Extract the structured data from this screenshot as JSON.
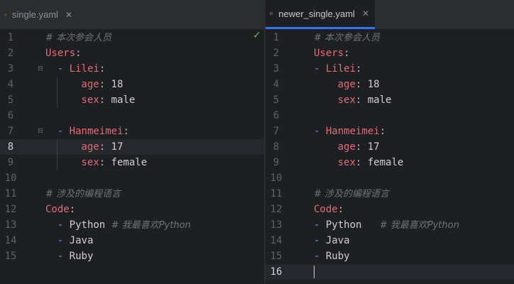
{
  "colors": {
    "accent": "#3574f0",
    "key": "#e06c75",
    "dash": "#56a8f5",
    "comment": "#6f737a"
  },
  "left": {
    "tab": {
      "label": "single.yaml",
      "close": "✕",
      "icon": "yaml-file-icon"
    },
    "line_numbers": [
      "1",
      "2",
      "3",
      "4",
      "5",
      "6",
      "7",
      "8",
      "9",
      "10",
      "11",
      "12",
      "13",
      "14",
      "15"
    ],
    "current_line": "8",
    "lines": [
      {
        "comment": "# 本次参会人员"
      },
      {
        "key": "Users",
        "colon": ":"
      },
      {
        "dash": "- ",
        "key": "Lilei",
        "colon": ":"
      },
      {
        "key": "age",
        "colon": ": ",
        "value": "18"
      },
      {
        "key": "sex",
        "colon": ": ",
        "value": "male"
      },
      {},
      {
        "dash": "- ",
        "key": "Hanmeimei",
        "colon": ":"
      },
      {
        "key": "age",
        "colon": ": ",
        "value": "17"
      },
      {
        "key": "sex",
        "colon": ": ",
        "value": "female"
      },
      {},
      {
        "comment": "# 涉及的编程语言"
      },
      {
        "key": "Code",
        "colon": ":"
      },
      {
        "dash": "- ",
        "value": "Python ",
        "comment": "# 我最喜欢Python"
      },
      {
        "dash": "- ",
        "value": "Java"
      },
      {
        "dash": "- ",
        "value": "Ruby"
      }
    ],
    "status_icon": "check-icon",
    "status_mark": "✓"
  },
  "right": {
    "tab": {
      "label": "newer_single.yaml",
      "close": "✕",
      "icon": "yaml-file-icon"
    },
    "line_numbers": [
      "1",
      "2",
      "3",
      "4",
      "5",
      "6",
      "7",
      "8",
      "9",
      "10",
      "11",
      "12",
      "13",
      "14",
      "15",
      "16"
    ],
    "current_line": "16",
    "lines": [
      {
        "comment": "# 本次参会人员"
      },
      {
        "key": "Users",
        "colon": ":"
      },
      {
        "dash": "- ",
        "key": "Lilei",
        "colon": ":"
      },
      {
        "key": "age",
        "colon": ": ",
        "value": "18"
      },
      {
        "key": "sex",
        "colon": ": ",
        "value": "male"
      },
      {},
      {
        "dash": "- ",
        "key": "Hanmeimei",
        "colon": ":"
      },
      {
        "key": "age",
        "colon": ": ",
        "value": "17"
      },
      {
        "key": "sex",
        "colon": ": ",
        "value": "female"
      },
      {},
      {
        "comment": "# 涉及的编程语言"
      },
      {
        "key": "Code",
        "colon": ":"
      },
      {
        "dash": "- ",
        "value": "Python   ",
        "comment": "# 我最喜欢Python"
      },
      {
        "dash": "- ",
        "value": "Java"
      },
      {
        "dash": "- ",
        "value": "Ruby"
      },
      {}
    ]
  }
}
